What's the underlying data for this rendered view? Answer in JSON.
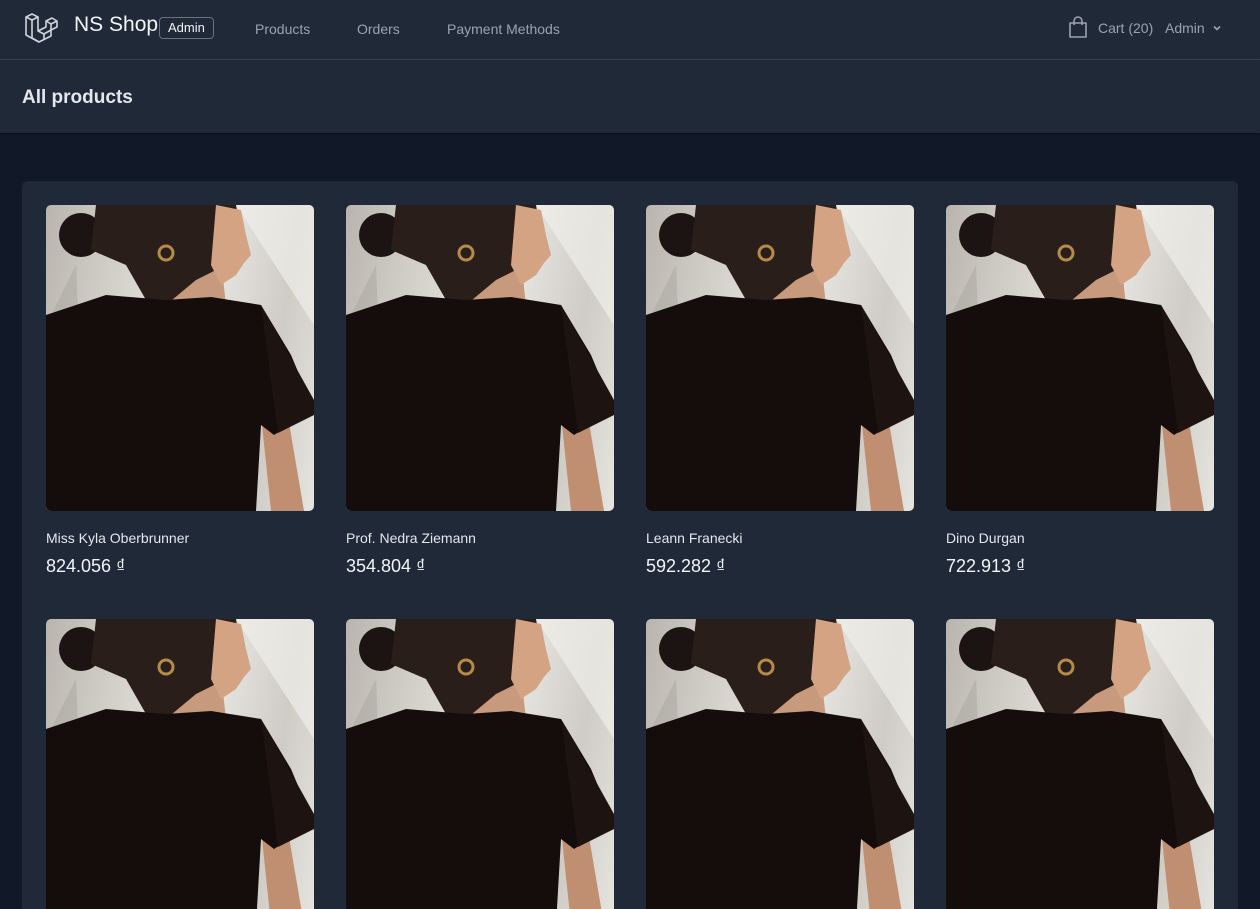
{
  "brand": {
    "name": "NS Shop",
    "badge": "Admin"
  },
  "nav": {
    "products": "Products",
    "orders": "Orders",
    "payment_methods": "Payment Methods"
  },
  "cart": {
    "label": "Cart (20)"
  },
  "user": {
    "name": "Admin"
  },
  "page": {
    "title": "All products"
  },
  "products": [
    {
      "name": "Miss Kyla Oberbrunner",
      "price": "824.056 ₫"
    },
    {
      "name": "Prof. Nedra Ziemann",
      "price": "354.804 ₫"
    },
    {
      "name": "Leann Franecki",
      "price": "592.282 ₫"
    },
    {
      "name": "Dino Durgan",
      "price": "722.913 ₫"
    },
    {
      "name": "",
      "price": ""
    },
    {
      "name": "",
      "price": ""
    },
    {
      "name": "",
      "price": ""
    },
    {
      "name": "",
      "price": ""
    }
  ],
  "colors": {
    "background": "#111827",
    "surface": "#1f2937",
    "text": "#e5e7eb",
    "muted": "#9ca3af"
  }
}
